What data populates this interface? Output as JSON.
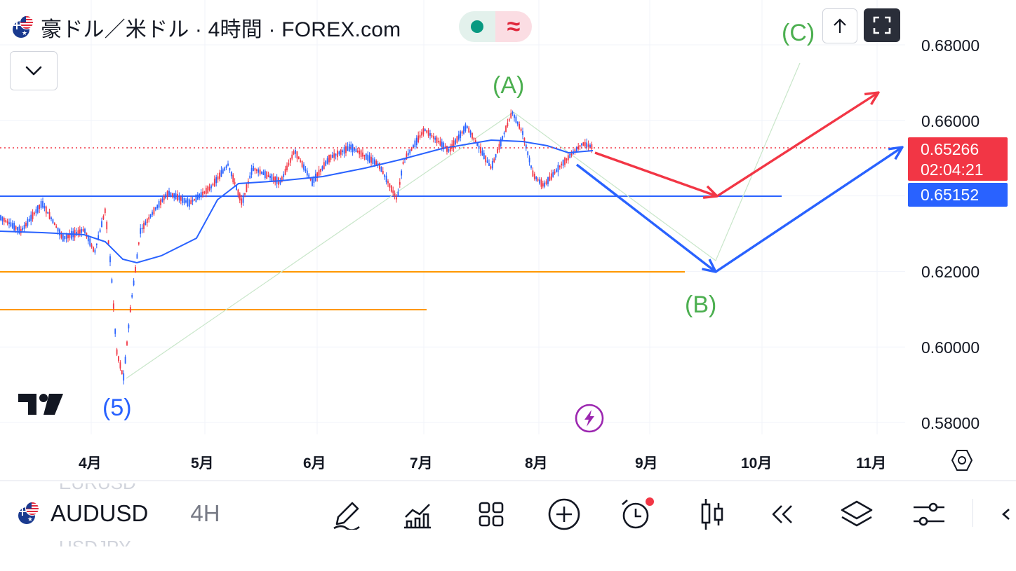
{
  "header": {
    "title": "豪ドル／米ドル · 4時間 · FOREX.com",
    "market_status_icon": "market-open-dot",
    "delay_icon": "approx-icon"
  },
  "price_scale": {
    "labels": [
      "0.68000",
      "0.66000",
      "0.62000",
      "0.60000",
      "0.58000"
    ],
    "last_price": "0.65266",
    "countdown": "02:04:21",
    "line_price": "0.65152"
  },
  "time_scale": {
    "labels": [
      "4月",
      "5月",
      "6月",
      "7月",
      "8月",
      "9月",
      "10月",
      "11月"
    ]
  },
  "annotations": {
    "wave_A": "(A)",
    "wave_B": "(B)",
    "wave_C": "(C)",
    "wave_5": "(5)"
  },
  "colors": {
    "up": "#f23645",
    "down": "#2962ff",
    "ma": "#2962ff",
    "support_blue": "#2962ff",
    "support_orange": "#ff9800",
    "wave_green": "#4caf50",
    "arrow_red": "#f23645",
    "arrow_blue": "#2962ff"
  },
  "toolbar": {
    "symbol": "AUDUSD",
    "interval": "4H",
    "prev_symbol": "EURUSD",
    "next_symbol": "USDJPY",
    "tools": [
      "draw-brush-icon",
      "indicators-icon",
      "layouts-icon",
      "add-icon",
      "alert-icon",
      "candle-style-icon",
      "replay-icon",
      "layers-icon",
      "settings-sliders-icon",
      "collapse-arrow-icon"
    ]
  }
}
